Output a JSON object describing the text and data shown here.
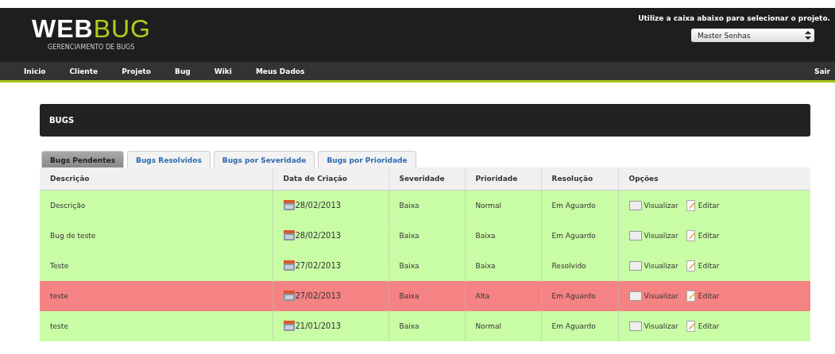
{
  "header": {
    "logo": {
      "part_1": "WEB",
      "part_2": "BUG"
    },
    "tagline": "GERENCIAMENTO DE BUGS",
    "project_hint": "Utilize a caixa abaixo para selecionar o projeto.",
    "project_select": {
      "value": "Master Senhas"
    }
  },
  "nav": {
    "items": [
      "Inicio",
      "Cliente",
      "Projeto",
      "Bug",
      "Wiki",
      "Meus Dados"
    ],
    "logout": "Sair"
  },
  "panel_title": "BUGS",
  "tabs": [
    {
      "label": "Bugs Pendentes",
      "selected": true
    },
    {
      "label": "Bugs Resolvidos",
      "selected": false
    },
    {
      "label": "Bugs por Severidade",
      "selected": false
    },
    {
      "label": "Bugs por Prioridade",
      "selected": false
    }
  ],
  "table": {
    "columns": [
      "Descrição",
      "Data de Criação",
      "Severidade",
      "Prioridade",
      "Resolução",
      "Opções"
    ],
    "rows": [
      {
        "description": "Descrição",
        "created": "28/02/2013",
        "severity": "Baixa",
        "priority": "Normal",
        "resolution": "Em Aguardo",
        "view": "Visualizar",
        "edit": "Editar",
        "color": "#c8fca5"
      },
      {
        "description": "Bug de teste",
        "created": "28/02/2013",
        "severity": "Baixa",
        "priority": "Baixa",
        "resolution": "Em Aguardo",
        "view": "Visualizar",
        "edit": "Editar",
        "color": "#c8fca5"
      },
      {
        "description": "Teste",
        "created": "27/02/2013",
        "severity": "Baixa",
        "priority": "Baixa",
        "resolution": "Resolvido",
        "view": "Visualizar",
        "edit": "Editar",
        "color": "#c8fca5"
      },
      {
        "description": "teste",
        "created": "27/02/2013",
        "severity": "Baixa",
        "priority": "Alta",
        "resolution": "Em Aguardo",
        "view": "Visualizar",
        "edit": "Editar",
        "color": "#f58383"
      },
      {
        "description": "teste",
        "created": "21/01/2013",
        "severity": "Baixa",
        "priority": "Normal",
        "resolution": "Em Aguardo",
        "view": "Visualizar",
        "edit": "Editar",
        "color": "#c8fca5"
      }
    ]
  }
}
